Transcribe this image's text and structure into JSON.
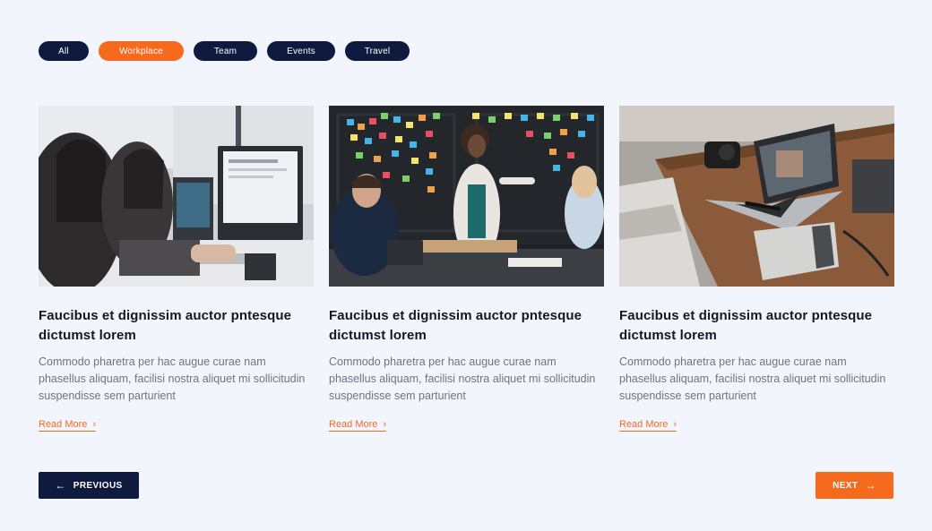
{
  "colors": {
    "navy": "#0e1b3e",
    "accent": "#f56a1d",
    "background": "#f3f5fd"
  },
  "filters": [
    {
      "label": "All",
      "active": false
    },
    {
      "label": "Workplace",
      "active": true
    },
    {
      "label": "Team",
      "active": false
    },
    {
      "label": "Events",
      "active": false
    },
    {
      "label": "Travel",
      "active": false
    }
  ],
  "cards": [
    {
      "image": "office-workers-at-computers-photo",
      "title": "Faucibus et dignissim auctor pntesque dictumst lorem",
      "text": "Commodo pharetra per hac augue curae nam phasellus aliquam, facilisi nostra aliquet mi sollicitudin suspendisse sem parturient",
      "link_label": "Read More",
      "link_icon": "chevron-right-icon"
    },
    {
      "image": "team-meeting-sticky-notes-photo",
      "title": "Faucibus et dignissim auctor pntesque dictumst lorem",
      "text": "Commodo pharetra per hac augue curae nam phasellus aliquam, facilisi nostra aliquet mi sollicitudin suspendisse sem parturient",
      "link_label": "Read More",
      "link_icon": "chevron-right-icon"
    },
    {
      "image": "laptop-on-wooden-desk-photo",
      "title": "Faucibus et dignissim auctor pntesque dictumst lorem",
      "text": "Commodo pharetra per hac augue curae nam phasellus aliquam, facilisi nostra aliquet mi sollicitudin suspendisse sem parturient",
      "link_label": "Read More",
      "link_icon": "chevron-right-icon"
    }
  ],
  "pagination": {
    "previous_label": "PREVIOUS",
    "previous_icon": "arrow-left-icon",
    "next_label": "NEXT",
    "next_icon": "arrow-right-icon"
  }
}
